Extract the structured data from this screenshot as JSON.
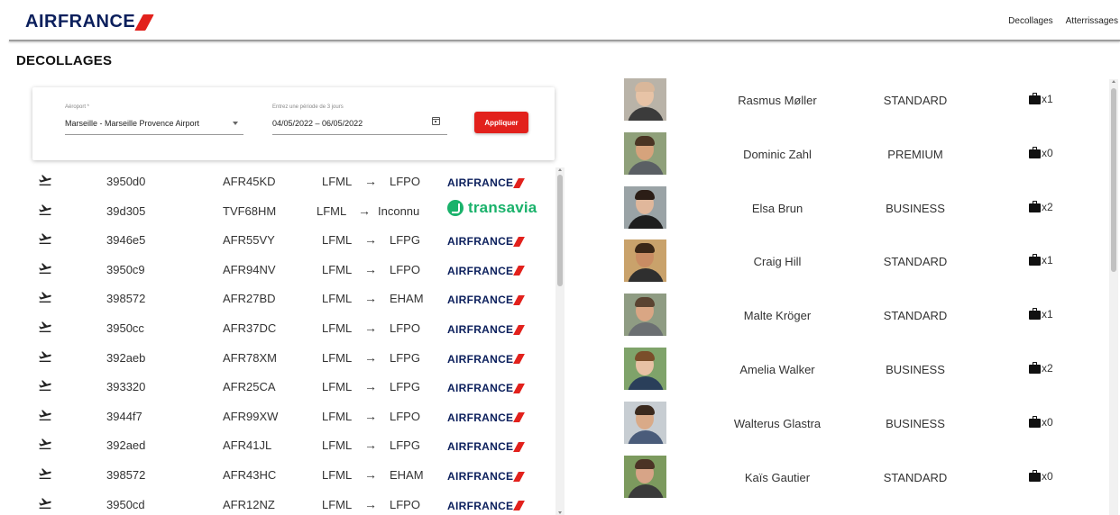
{
  "header": {
    "logo_text": "AIRFRANCE",
    "nav": [
      {
        "label": "Decollages"
      },
      {
        "label": "Atterrissages"
      }
    ]
  },
  "page_title": "DECOLLAGES",
  "filters": {
    "airport": {
      "label": "Aéroport *",
      "value": "Marseille - Marseille Provence Airport"
    },
    "period": {
      "label": "Entrez une période de 3 jours",
      "value": "04/05/2022 – 06/05/2022"
    },
    "apply_label": "Appliquer"
  },
  "flights": [
    {
      "id": "3950d0",
      "callsign": "AFR45KD",
      "from": "LFML",
      "arrow": "→",
      "to": "LFPO",
      "airline": "airfrance"
    },
    {
      "id": "39d305",
      "callsign": "TVF68HM",
      "from": "LFML",
      "arrow": "→",
      "to": "Inconnu",
      "airline": "transavia"
    },
    {
      "id": "3946e5",
      "callsign": "AFR55VY",
      "from": "LFML",
      "arrow": "→",
      "to": "LFPG",
      "airline": "airfrance"
    },
    {
      "id": "3950c9",
      "callsign": "AFR94NV",
      "from": "LFML",
      "arrow": "→",
      "to": "LFPO",
      "airline": "airfrance"
    },
    {
      "id": "398572",
      "callsign": "AFR27BD",
      "from": "LFML",
      "arrow": "→",
      "to": "EHAM",
      "airline": "airfrance"
    },
    {
      "id": "3950cc",
      "callsign": "AFR37DC",
      "from": "LFML",
      "arrow": "→",
      "to": "LFPO",
      "airline": "airfrance"
    },
    {
      "id": "392aeb",
      "callsign": "AFR78XM",
      "from": "LFML",
      "arrow": "→",
      "to": "LFPG",
      "airline": "airfrance"
    },
    {
      "id": "393320",
      "callsign": "AFR25CA",
      "from": "LFML",
      "arrow": "→",
      "to": "LFPG",
      "airline": "airfrance"
    },
    {
      "id": "3944f7",
      "callsign": "AFR99XW",
      "from": "LFML",
      "arrow": "→",
      "to": "LFPO",
      "airline": "airfrance"
    },
    {
      "id": "392aed",
      "callsign": "AFR41JL",
      "from": "LFML",
      "arrow": "→",
      "to": "LFPG",
      "airline": "airfrance"
    },
    {
      "id": "398572",
      "callsign": "AFR43HC",
      "from": "LFML",
      "arrow": "→",
      "to": "EHAM",
      "airline": "airfrance"
    },
    {
      "id": "3950cd",
      "callsign": "AFR12NZ",
      "from": "LFML",
      "arrow": "→",
      "to": "LFPO",
      "airline": "airfrance"
    }
  ],
  "airline_labels": {
    "airfrance": "AIRFRANCE",
    "transavia": "transavia"
  },
  "passengers": [
    {
      "name": "Rasmus Møller",
      "class": "STANDARD",
      "bags": "x1"
    },
    {
      "name": "Dominic Zahl",
      "class": "PREMIUM",
      "bags": "x0"
    },
    {
      "name": "Elsa Brun",
      "class": "BUSINESS",
      "bags": "x2"
    },
    {
      "name": "Craig Hill",
      "class": "STANDARD",
      "bags": "x1"
    },
    {
      "name": "Malte Kröger",
      "class": "STANDARD",
      "bags": "x1"
    },
    {
      "name": "Amelia Walker",
      "class": "BUSINESS",
      "bags": "x2"
    },
    {
      "name": "Walterus Glastra",
      "class": "BUSINESS",
      "bags": "x0"
    },
    {
      "name": "Kaïs Gautier",
      "class": "STANDARD",
      "bags": "x0"
    }
  ],
  "colors": {
    "brand_blue": "#0b1f5c",
    "brand_red": "#e2211c",
    "transavia_green": "#1ab26b"
  },
  "icons": {
    "flight_row": "takeoff-icon",
    "airport_dropdown": "dropdown-arrow-icon",
    "period_picker": "calendar-icon",
    "baggage": "luggage-icon"
  }
}
